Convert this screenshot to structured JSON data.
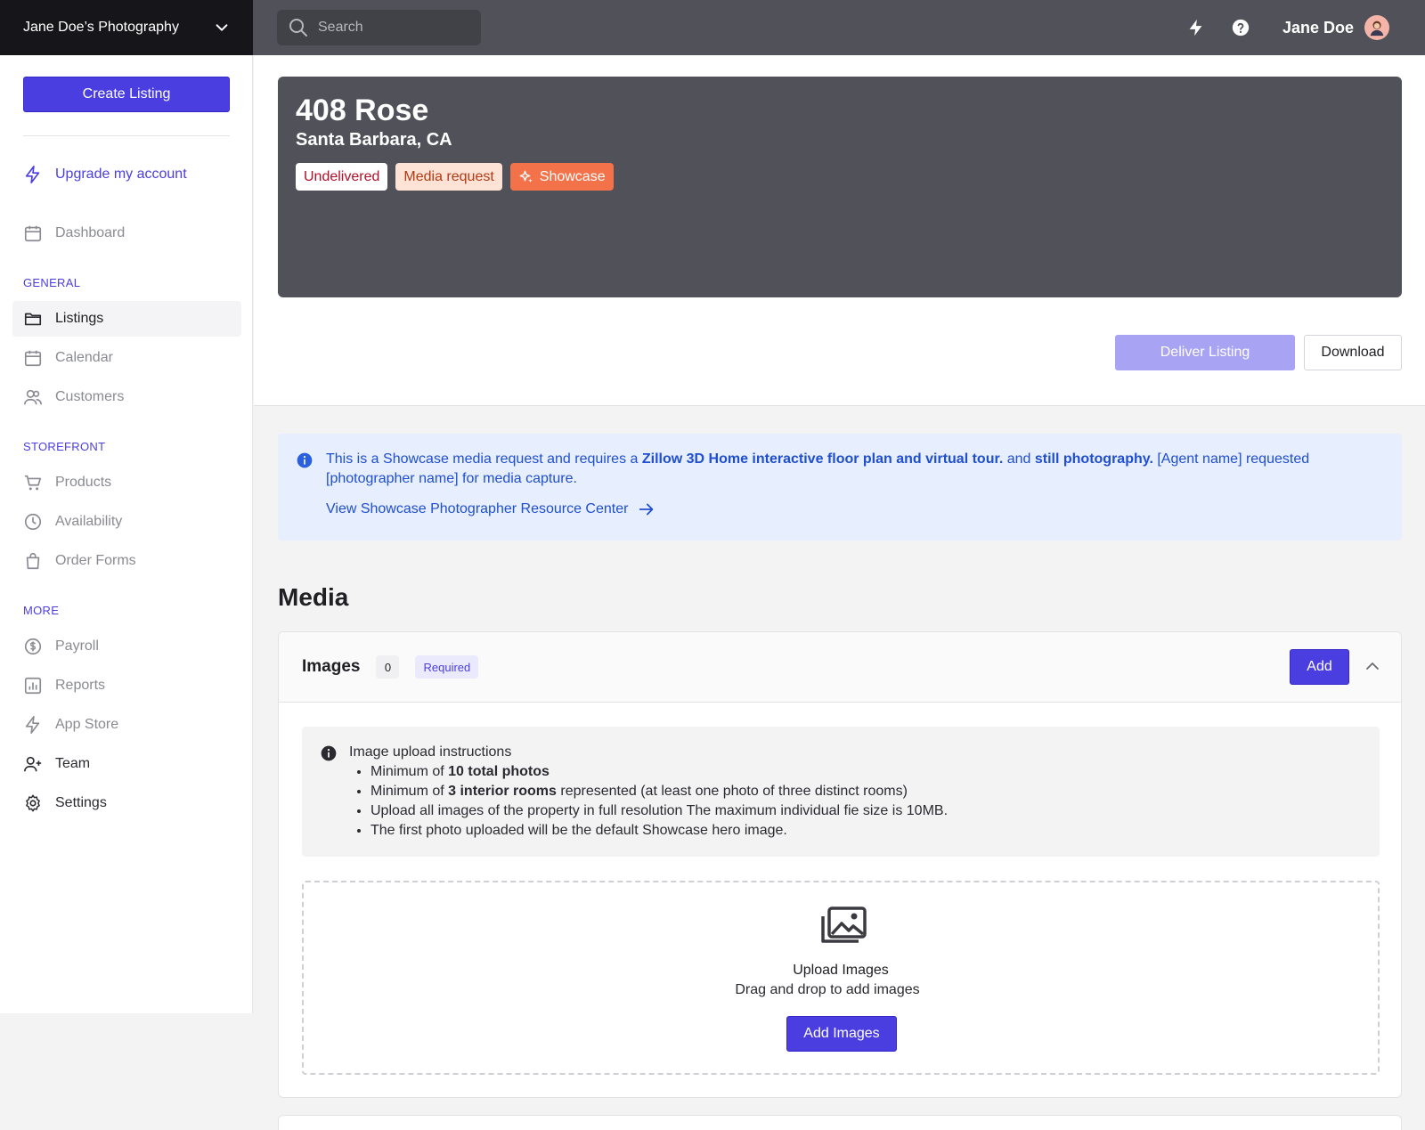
{
  "brand": {
    "name": "Jane Doe’s Photography"
  },
  "search": {
    "placeholder": "Search"
  },
  "user": {
    "name": "Jane Doe"
  },
  "sidebar": {
    "create_label": "Create Listing",
    "upgrade_label": "Upgrade my account",
    "dashboard_label": "Dashboard",
    "sections": {
      "general": "GENERAL",
      "storefront": "STOREFRONT",
      "more": "MORE"
    },
    "general_items": [
      "Listings",
      "Calendar",
      "Customers"
    ],
    "storefront_items": [
      "Products",
      "Availability",
      "Order Forms"
    ],
    "more_items": [
      "Payroll",
      "Reports",
      "App Store",
      "Team",
      "Settings"
    ]
  },
  "listing": {
    "title": "408 Rose",
    "location": "Santa Barbara, CA",
    "tags": [
      "Undelivered",
      "Media request",
      "Showcase"
    ],
    "deliver_label": "Deliver Listing",
    "download_label": "Download"
  },
  "notice": {
    "text_1": "This is a Showcase media request and requires a ",
    "bold_1": "Zillow 3D Home interactive floor plan and virtual tour.",
    "text_2": " and ",
    "bold_2": "still photography.",
    "text_3": "  [Agent name] requested [photographer name] for media capture.",
    "link_label": "View Showcase Photographer Resource Center"
  },
  "media": {
    "title": "Media",
    "images": {
      "title": "Images",
      "count": "0",
      "required_label": "Required",
      "add_label": "Add",
      "instructions_title": "Image upload instructions",
      "rules": {
        "r1_pre": "Minimum of ",
        "r1_bold": "10 total photos",
        "r2_pre": "Minimum of ",
        "r2_bold": "3 interior rooms",
        "r2_post": " represented (at least one photo of three distinct rooms)",
        "r3": "Upload all images of the property in full resolution The maximum individual fie size is 10MB.",
        "r4": "The first photo uploaded will be the default Showcase hero image."
      },
      "upload_title": "Upload Images",
      "upload_sub": "Drag and drop to add images",
      "add_images_label": "Add Images"
    }
  },
  "colors": {
    "accent": "#4b3ee0",
    "topbar": "#515159",
    "brandbar": "#16161a",
    "notice_bg": "#e7eefd",
    "showcase": "#f4724a"
  }
}
